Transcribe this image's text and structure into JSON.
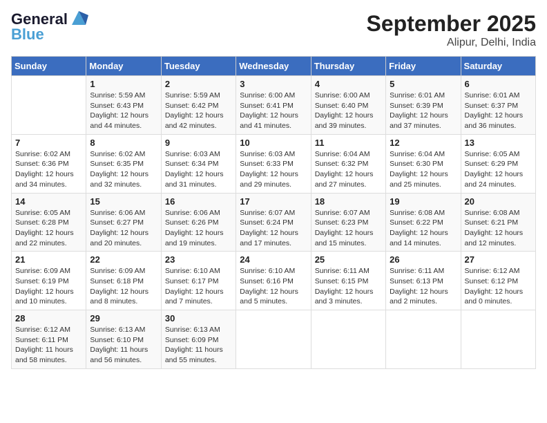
{
  "logo": {
    "line1": "General",
    "line2": "Blue"
  },
  "title": "September 2025",
  "location": "Alipur, Delhi, India",
  "days_header": [
    "Sunday",
    "Monday",
    "Tuesday",
    "Wednesday",
    "Thursday",
    "Friday",
    "Saturday"
  ],
  "weeks": [
    [
      {
        "day": "",
        "info": ""
      },
      {
        "day": "1",
        "info": "Sunrise: 5:59 AM\nSunset: 6:43 PM\nDaylight: 12 hours\nand 44 minutes."
      },
      {
        "day": "2",
        "info": "Sunrise: 5:59 AM\nSunset: 6:42 PM\nDaylight: 12 hours\nand 42 minutes."
      },
      {
        "day": "3",
        "info": "Sunrise: 6:00 AM\nSunset: 6:41 PM\nDaylight: 12 hours\nand 41 minutes."
      },
      {
        "day": "4",
        "info": "Sunrise: 6:00 AM\nSunset: 6:40 PM\nDaylight: 12 hours\nand 39 minutes."
      },
      {
        "day": "5",
        "info": "Sunrise: 6:01 AM\nSunset: 6:39 PM\nDaylight: 12 hours\nand 37 minutes."
      },
      {
        "day": "6",
        "info": "Sunrise: 6:01 AM\nSunset: 6:37 PM\nDaylight: 12 hours\nand 36 minutes."
      }
    ],
    [
      {
        "day": "7",
        "info": "Sunrise: 6:02 AM\nSunset: 6:36 PM\nDaylight: 12 hours\nand 34 minutes."
      },
      {
        "day": "8",
        "info": "Sunrise: 6:02 AM\nSunset: 6:35 PM\nDaylight: 12 hours\nand 32 minutes."
      },
      {
        "day": "9",
        "info": "Sunrise: 6:03 AM\nSunset: 6:34 PM\nDaylight: 12 hours\nand 31 minutes."
      },
      {
        "day": "10",
        "info": "Sunrise: 6:03 AM\nSunset: 6:33 PM\nDaylight: 12 hours\nand 29 minutes."
      },
      {
        "day": "11",
        "info": "Sunrise: 6:04 AM\nSunset: 6:32 PM\nDaylight: 12 hours\nand 27 minutes."
      },
      {
        "day": "12",
        "info": "Sunrise: 6:04 AM\nSunset: 6:30 PM\nDaylight: 12 hours\nand 25 minutes."
      },
      {
        "day": "13",
        "info": "Sunrise: 6:05 AM\nSunset: 6:29 PM\nDaylight: 12 hours\nand 24 minutes."
      }
    ],
    [
      {
        "day": "14",
        "info": "Sunrise: 6:05 AM\nSunset: 6:28 PM\nDaylight: 12 hours\nand 22 minutes."
      },
      {
        "day": "15",
        "info": "Sunrise: 6:06 AM\nSunset: 6:27 PM\nDaylight: 12 hours\nand 20 minutes."
      },
      {
        "day": "16",
        "info": "Sunrise: 6:06 AM\nSunset: 6:26 PM\nDaylight: 12 hours\nand 19 minutes."
      },
      {
        "day": "17",
        "info": "Sunrise: 6:07 AM\nSunset: 6:24 PM\nDaylight: 12 hours\nand 17 minutes."
      },
      {
        "day": "18",
        "info": "Sunrise: 6:07 AM\nSunset: 6:23 PM\nDaylight: 12 hours\nand 15 minutes."
      },
      {
        "day": "19",
        "info": "Sunrise: 6:08 AM\nSunset: 6:22 PM\nDaylight: 12 hours\nand 14 minutes."
      },
      {
        "day": "20",
        "info": "Sunrise: 6:08 AM\nSunset: 6:21 PM\nDaylight: 12 hours\nand 12 minutes."
      }
    ],
    [
      {
        "day": "21",
        "info": "Sunrise: 6:09 AM\nSunset: 6:19 PM\nDaylight: 12 hours\nand 10 minutes."
      },
      {
        "day": "22",
        "info": "Sunrise: 6:09 AM\nSunset: 6:18 PM\nDaylight: 12 hours\nand 8 minutes."
      },
      {
        "day": "23",
        "info": "Sunrise: 6:10 AM\nSunset: 6:17 PM\nDaylight: 12 hours\nand 7 minutes."
      },
      {
        "day": "24",
        "info": "Sunrise: 6:10 AM\nSunset: 6:16 PM\nDaylight: 12 hours\nand 5 minutes."
      },
      {
        "day": "25",
        "info": "Sunrise: 6:11 AM\nSunset: 6:15 PM\nDaylight: 12 hours\nand 3 minutes."
      },
      {
        "day": "26",
        "info": "Sunrise: 6:11 AM\nSunset: 6:13 PM\nDaylight: 12 hours\nand 2 minutes."
      },
      {
        "day": "27",
        "info": "Sunrise: 6:12 AM\nSunset: 6:12 PM\nDaylight: 12 hours\nand 0 minutes."
      }
    ],
    [
      {
        "day": "28",
        "info": "Sunrise: 6:12 AM\nSunset: 6:11 PM\nDaylight: 11 hours\nand 58 minutes."
      },
      {
        "day": "29",
        "info": "Sunrise: 6:13 AM\nSunset: 6:10 PM\nDaylight: 11 hours\nand 56 minutes."
      },
      {
        "day": "30",
        "info": "Sunrise: 6:13 AM\nSunset: 6:09 PM\nDaylight: 11 hours\nand 55 minutes."
      },
      {
        "day": "",
        "info": ""
      },
      {
        "day": "",
        "info": ""
      },
      {
        "day": "",
        "info": ""
      },
      {
        "day": "",
        "info": ""
      }
    ]
  ]
}
